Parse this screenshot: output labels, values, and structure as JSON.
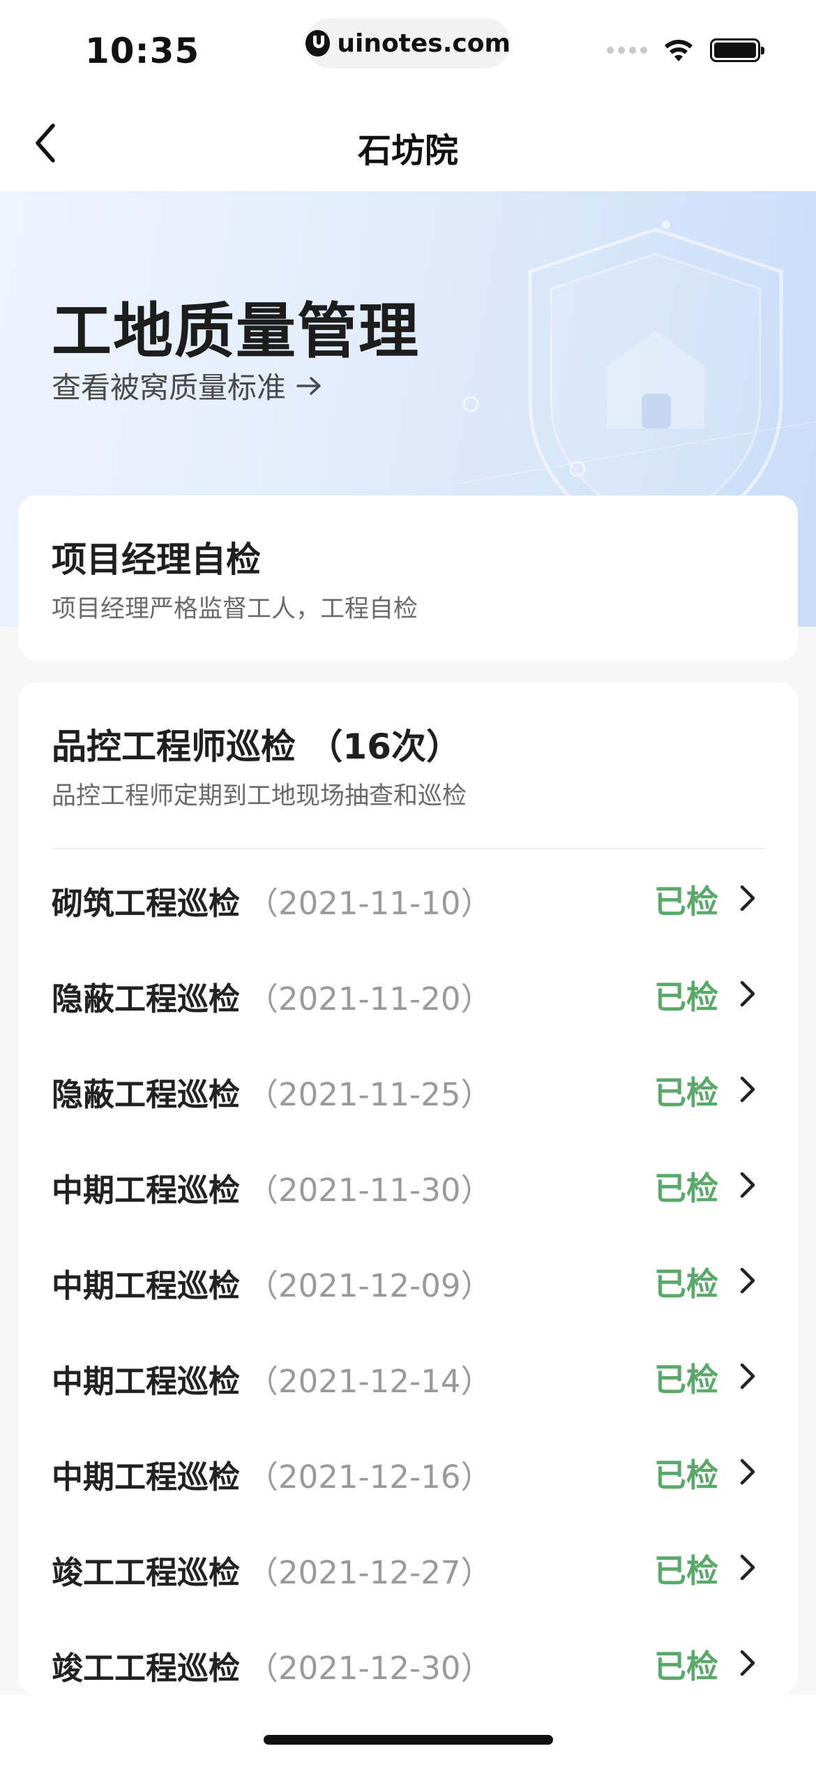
{
  "status_bar": {
    "time": "10:35",
    "url": "uinotes.com",
    "icons": [
      "signal-icon",
      "wifi-icon",
      "battery-icon"
    ]
  },
  "nav": {
    "title": "石坊院",
    "back_icon": "chevron-left-icon"
  },
  "hero": {
    "title": "工地质量管理",
    "link_text": "查看被窝质量标准",
    "link_icon": "arrow-right-icon"
  },
  "self_check": {
    "title": "项目经理自检",
    "subtitle": "项目经理严格监督工人，工程自检"
  },
  "inspection": {
    "title": "品控工程师巡检 （16次）",
    "subtitle": "品控工程师定期到工地现场抽查和巡检",
    "items": [
      {
        "name": "砌筑工程巡检",
        "date": "（2021-11-10）",
        "status": "已检"
      },
      {
        "name": "隐蔽工程巡检",
        "date": "（2021-11-20）",
        "status": "已检"
      },
      {
        "name": "隐蔽工程巡检",
        "date": "（2021-11-25）",
        "status": "已检"
      },
      {
        "name": "中期工程巡检",
        "date": "（2021-11-30）",
        "status": "已检"
      },
      {
        "name": "中期工程巡检",
        "date": "（2021-12-09）",
        "status": "已检"
      },
      {
        "name": "中期工程巡检",
        "date": "（2021-12-14）",
        "status": "已检"
      },
      {
        "name": "中期工程巡检",
        "date": "（2021-12-16）",
        "status": "已检"
      },
      {
        "name": "竣工工程巡检",
        "date": "（2021-12-27）",
        "status": "已检"
      },
      {
        "name": "竣工工程巡检",
        "date": "（2021-12-30）",
        "status": "已检"
      }
    ]
  },
  "colors": {
    "status_green": "#5aa86a",
    "hero_gradient_start": "#eef4fd",
    "hero_gradient_end": "#c9dcf8"
  }
}
